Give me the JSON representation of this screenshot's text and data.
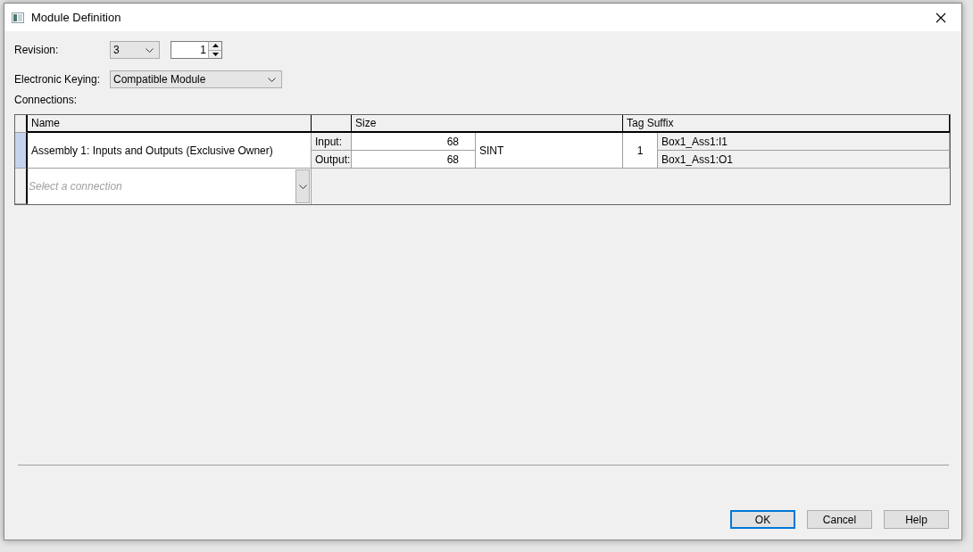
{
  "window": {
    "title": "Module Definition"
  },
  "revision": {
    "label": "Revision:",
    "major": "3",
    "minor": "1"
  },
  "electronic_keying": {
    "label": "Electronic Keying:",
    "value": "Compatible Module"
  },
  "connections": {
    "label": "Connections:",
    "name_header": "Name",
    "size_header": "Size",
    "tag_suffix_header": "Tag Suffix",
    "rows": [
      {
        "selected": true,
        "name": "Assembly 1: Inputs and Outputs (Exclusive Owner)",
        "input_label": "Input:",
        "input_size": "68",
        "output_label": "Output:",
        "output_size": "68",
        "data_type": "SINT",
        "tag_number": "1",
        "input_tag": "Box1_Ass1:I1",
        "output_tag": "Box1_Ass1:O1"
      }
    ],
    "new_row": {
      "placeholder": "Select a connection"
    }
  },
  "buttons": [
    {
      "label": "OK",
      "focused": true
    },
    {
      "label": "Cancel",
      "focused": false
    },
    {
      "label": "Help",
      "focused": false
    }
  ]
}
